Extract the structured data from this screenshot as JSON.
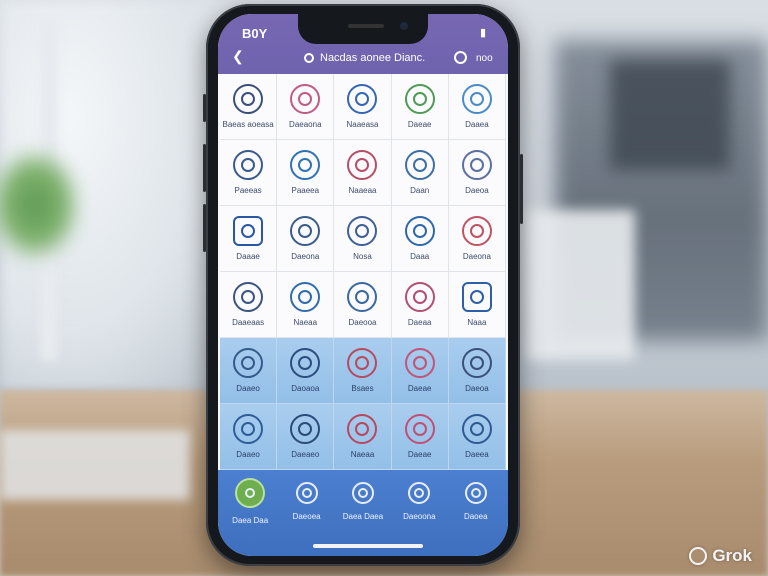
{
  "status": {
    "time": "B0Y",
    "right": ""
  },
  "appbar": {
    "left_icon": "back-icon",
    "title": "Nacdas aonee Dianc.",
    "right_text": "noo"
  },
  "grid": {
    "cells": [
      {
        "label": "Baeas aoeasa",
        "icon": "bird-icon",
        "color": "#3a4f7a",
        "style": "plain"
      },
      {
        "label": "Daeaona",
        "icon": "pig-icon",
        "color": "#c05b86",
        "style": "plain"
      },
      {
        "label": "Naaeasa",
        "icon": "message-icon",
        "color": "#3466b8",
        "style": "plain"
      },
      {
        "label": "Daeae",
        "icon": "leaf-icon",
        "color": "#4f9a55",
        "style": "plain"
      },
      {
        "label": "Daaea",
        "icon": "globe-icon",
        "color": "#4a8ac9",
        "style": "plain"
      },
      {
        "label": "Paeeas",
        "icon": "badge-icon",
        "color": "#3b5a8c",
        "style": "plain"
      },
      {
        "label": "Paaeea",
        "icon": "chat-icon",
        "color": "#2f72b5",
        "style": "plain"
      },
      {
        "label": "Naaeaa",
        "icon": "lips-icon",
        "color": "#b74e68",
        "style": "plain"
      },
      {
        "label": "Daan",
        "icon": "flame-icon",
        "color": "#3e6ea8",
        "style": "plain"
      },
      {
        "label": "Daeoa",
        "icon": "shoe-icon",
        "color": "#5b6fa3",
        "style": "plain"
      },
      {
        "label": "Daaae",
        "icon": "book-icon",
        "color": "#2b56a0",
        "style": "square"
      },
      {
        "label": "Daeona",
        "icon": "dog-icon",
        "color": "#3a5c8d",
        "style": "plain"
      },
      {
        "label": "Nosa",
        "icon": "flower-icon",
        "color": "#3e5f98",
        "style": "plain"
      },
      {
        "label": "Daaa",
        "icon": "tag-icon",
        "color": "#2d68ad",
        "style": "plain"
      },
      {
        "label": "Daeona",
        "icon": "sprout-icon",
        "color": "#c0535f",
        "style": "plain"
      },
      {
        "label": "Daaeaas",
        "icon": "target-icon",
        "color": "#3c5580",
        "style": "plain"
      },
      {
        "label": "Naeaa",
        "icon": "horse-icon",
        "color": "#2f6cb0",
        "style": "plain"
      },
      {
        "label": "Daeooa",
        "icon": "chat-bubble-icon",
        "color": "#3a68a5",
        "style": "plain"
      },
      {
        "label": "Daeaa",
        "icon": "heart-icon",
        "color": "#b4506f",
        "style": "plain"
      },
      {
        "label": "Naaa",
        "icon": "photo-icon",
        "color": "#2e5fa6",
        "style": "square"
      },
      {
        "label": "Daaeo",
        "icon": "camera-icon",
        "color": "#345a8a",
        "style": "blue"
      },
      {
        "label": "Daoaoa",
        "icon": "aperture-icon",
        "color": "#2c4d7d",
        "style": "blue"
      },
      {
        "label": "Bsaes",
        "icon": "shell-icon",
        "color": "#b84a60",
        "style": "blue"
      },
      {
        "label": "Daeae",
        "icon": "rose-icon",
        "color": "#c15478",
        "style": "blue"
      },
      {
        "label": "Daeoa",
        "icon": "crystal-icon",
        "color": "#3a4f7a",
        "style": "blue"
      },
      {
        "label": "Daaeo",
        "icon": "ring-icon",
        "color": "#2f5d98",
        "style": "blue"
      },
      {
        "label": "Daeaeo",
        "icon": "rose-outline-icon",
        "color": "#2a4a78",
        "style": "blue"
      },
      {
        "label": "Naeaa",
        "icon": "seal-icon",
        "color": "#b8485e",
        "style": "blue"
      },
      {
        "label": "Daeae",
        "icon": "circle-heart-icon",
        "color": "#c04f78",
        "style": "blue"
      },
      {
        "label": "Daeea",
        "icon": "teacup-icon",
        "color": "#2f5a8f",
        "style": "blue"
      }
    ]
  },
  "tabbar": {
    "tabs": [
      {
        "label": "Daea Daa",
        "icon": "home-icon"
      },
      {
        "label": "Daeoea",
        "icon": "compass-icon"
      },
      {
        "label": "Daea Daea",
        "icon": "search-icon"
      },
      {
        "label": "Daeoona",
        "icon": "bell-icon"
      },
      {
        "label": "Daoea",
        "icon": "profile-icon"
      }
    ]
  },
  "watermark": {
    "text": "Grok"
  }
}
